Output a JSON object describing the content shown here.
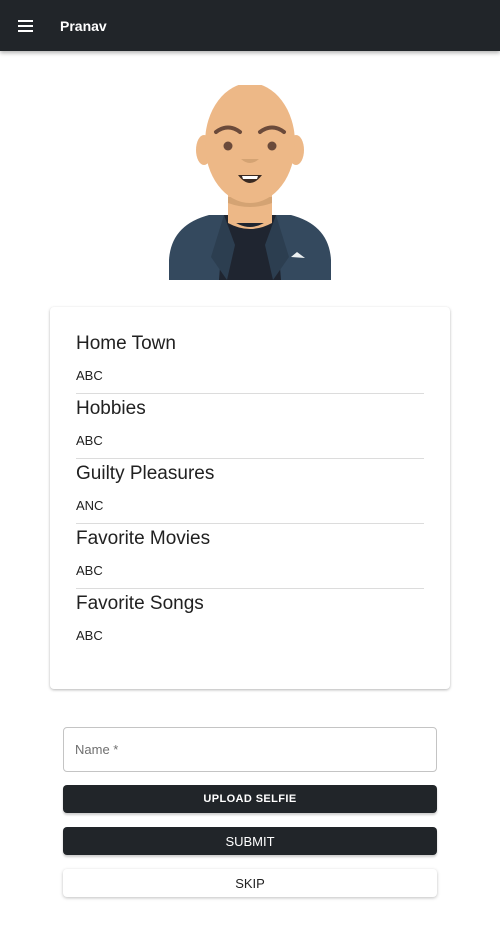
{
  "app_bar": {
    "title": "Pranav",
    "menu_icon": "hamburger-menu-icon"
  },
  "avatar": {
    "icon": "person-avatar-illustration",
    "skin_color": "#EDB887",
    "jacket_color": "#34495E"
  },
  "profile": {
    "items": [
      {
        "label": "Home Town",
        "value": "ABC"
      },
      {
        "label": "Hobbies",
        "value": "ABC"
      },
      {
        "label": "Guilty Pleasures",
        "value": "ANC"
      },
      {
        "label": "Favorite Movies",
        "value": "ABC"
      },
      {
        "label": "Favorite Songs",
        "value": "ABC"
      }
    ]
  },
  "form": {
    "name_placeholder": "Name *",
    "upload_label": "UPLOAD SELFIE",
    "submit_label": "SUBMIT",
    "skip_label": "SKIP"
  },
  "colors": {
    "app_bar": "#212529",
    "primary_button": "#212529"
  }
}
